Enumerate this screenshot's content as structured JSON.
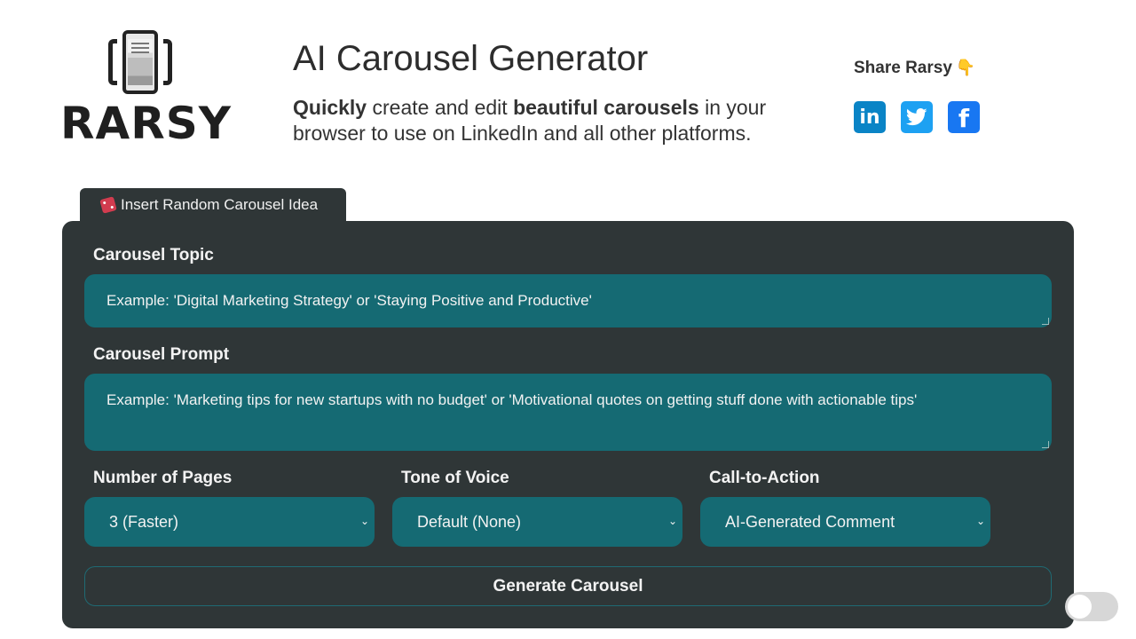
{
  "brand": {
    "logo_text": "RARSY"
  },
  "header": {
    "title": "AI Carousel Generator",
    "subtitle_parts": [
      {
        "text": "Quickly",
        "bold": true
      },
      {
        "text": " create and edit ",
        "bold": false
      },
      {
        "text": "beautiful carousels",
        "bold": true
      },
      {
        "text": " in your browser to use on LinkedIn and all other platforms.",
        "bold": false
      }
    ]
  },
  "share": {
    "label": "Share Rarsy",
    "emoji": "👇",
    "networks": [
      {
        "name": "LinkedIn",
        "icon": "linkedin-icon",
        "glyph": "in",
        "color": "#0a84c6"
      },
      {
        "name": "Twitter",
        "icon": "twitter-icon",
        "glyph": "",
        "color": "#1da1f2"
      },
      {
        "name": "Facebook",
        "icon": "facebook-icon",
        "glyph": "f",
        "color": "#1877f2"
      }
    ]
  },
  "random_tab": {
    "label": "Insert Random Carousel Idea",
    "icon": "dice-icon"
  },
  "form": {
    "topic": {
      "label": "Carousel Topic",
      "placeholder": "Example: 'Digital Marketing Strategy' or 'Staying Positive and Productive'"
    },
    "prompt": {
      "label": "Carousel Prompt",
      "placeholder": "Example: 'Marketing tips for new startups with no budget' or 'Motivational quotes on getting stuff done with actionable tips'"
    },
    "pages": {
      "label": "Number of Pages",
      "selected": "3 (Faster)"
    },
    "tone": {
      "label": "Tone of Voice",
      "selected": "Default (None)"
    },
    "cta": {
      "label": "Call-to-Action",
      "selected": "AI-Generated Comment"
    },
    "generate_label": "Generate Carousel"
  },
  "colors": {
    "panel": "#2f3637",
    "field": "#156a73",
    "text_light": "#f3f3f3"
  },
  "theme_toggle": {
    "state": "off"
  }
}
